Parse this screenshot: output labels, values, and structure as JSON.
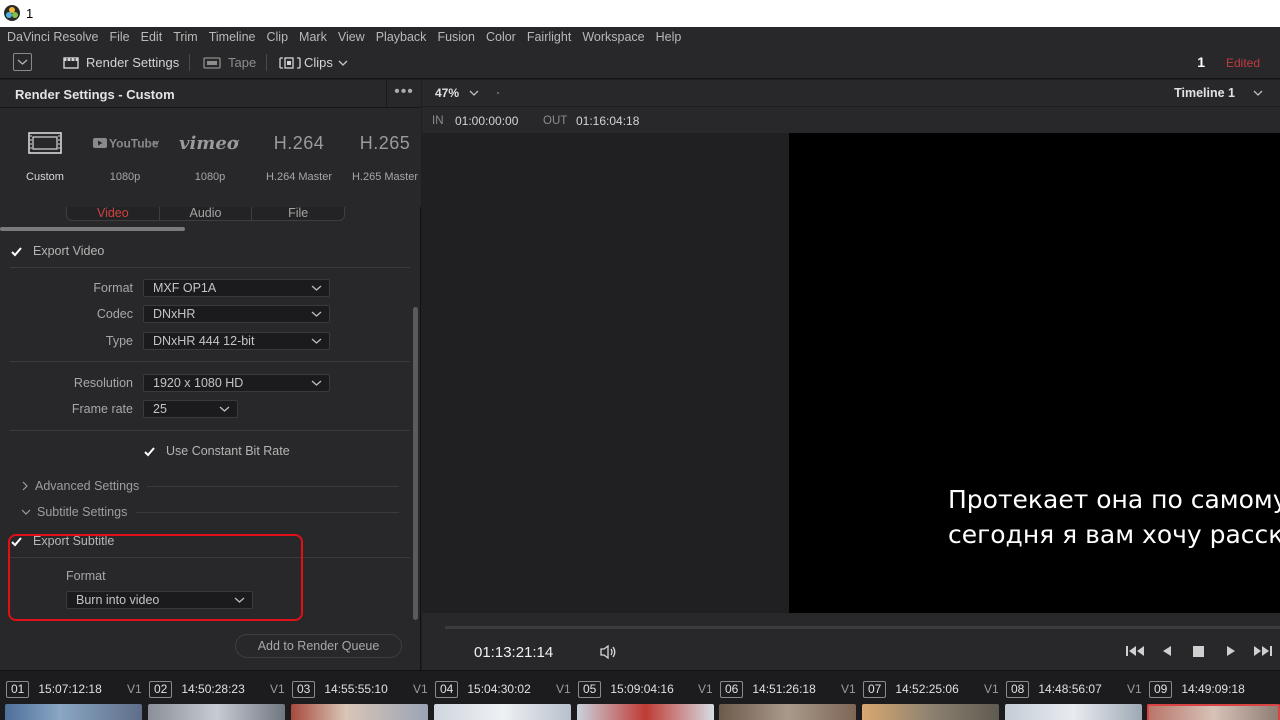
{
  "window": {
    "title": "1"
  },
  "menu": [
    "DaVinci Resolve",
    "File",
    "Edit",
    "Trim",
    "Timeline",
    "Clip",
    "Mark",
    "View",
    "Playback",
    "Fusion",
    "Color",
    "Fairlight",
    "Workspace",
    "Help"
  ],
  "toolbar": {
    "render_settings": "Render Settings",
    "tape": "Tape",
    "clips": "Clips",
    "project_number": "1",
    "status": "Edited"
  },
  "render_panel": {
    "title": "Render Settings - Custom",
    "more": "•••",
    "presets": [
      {
        "name": "Custom",
        "icon": "film-strip-icon"
      },
      {
        "name": "1080p",
        "icon": "youtube-icon",
        "logo_text": "YouTube"
      },
      {
        "name": "1080p",
        "icon": "vimeo-icon",
        "logo_text": "vimeo"
      },
      {
        "name": "H.264 Master",
        "logo_text": "H.264"
      },
      {
        "name": "H.265 Master",
        "logo_text": "H.265"
      }
    ],
    "tabs": [
      "Video",
      "Audio",
      "File"
    ],
    "active_tab": "Video",
    "export_video": {
      "label": "Export Video",
      "checked": true
    },
    "format": {
      "label": "Format",
      "value": "MXF OP1A"
    },
    "codec": {
      "label": "Codec",
      "value": "DNxHR"
    },
    "type": {
      "label": "Type",
      "value": "DNxHR 444 12-bit"
    },
    "resolution": {
      "label": "Resolution",
      "value": "1920 x 1080 HD"
    },
    "frame_rate": {
      "label": "Frame rate",
      "value": "25"
    },
    "constant_bit_rate": {
      "label": "Use Constant Bit Rate",
      "checked": true
    },
    "advanced_settings": "Advanced Settings",
    "subtitle_settings": "Subtitle Settings",
    "export_subtitle": {
      "label": "Export Subtitle",
      "checked": true
    },
    "subtitle_format": {
      "label": "Format",
      "value": "Burn into video"
    },
    "add_to_queue": "Add to Render Queue"
  },
  "viewer": {
    "zoom": "47%",
    "timeline": "Timeline 1",
    "in_label": "IN",
    "in_tc": "01:00:00:00",
    "out_label": "OUT",
    "out_tc": "01:16:04:18",
    "subtitle_line1": "Протекает она по самому",
    "subtitle_line2": "сегодня я вам хочу рассказ",
    "timecode": "01:13:21:14"
  },
  "clips": [
    {
      "num": "01",
      "tc": "15:07:12:18",
      "track": "V1"
    },
    {
      "num": "02",
      "tc": "14:50:28:23",
      "track": "V1"
    },
    {
      "num": "03",
      "tc": "14:55:55:10",
      "track": "V1"
    },
    {
      "num": "04",
      "tc": "15:04:30:02",
      "track": "V1"
    },
    {
      "num": "05",
      "tc": "15:09:04:16",
      "track": "V1"
    },
    {
      "num": "06",
      "tc": "14:51:26:18",
      "track": "V1"
    },
    {
      "num": "07",
      "tc": "14:52:25:06",
      "track": "V1"
    },
    {
      "num": "08",
      "tc": "14:48:56:07",
      "track": "V1"
    },
    {
      "num": "09",
      "tc": "14:49:09:18",
      "track": ""
    }
  ],
  "colors": {
    "accent_red": "#d0423f",
    "highlight": "#e01016",
    "panel": "#28282b",
    "frame": "#000000"
  }
}
